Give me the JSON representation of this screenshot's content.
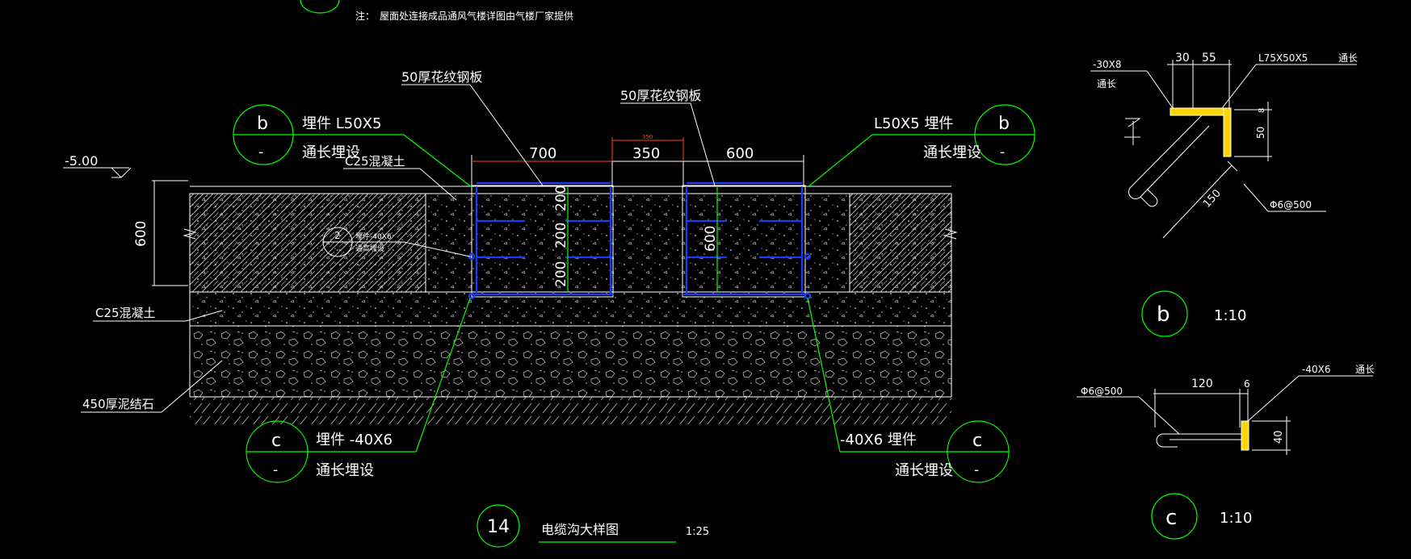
{
  "note": {
    "prefix": "注：",
    "text": "屋面处连接成品通风气楼详图由气楼厂家提供"
  },
  "main": {
    "ref_number": "14",
    "title": "电缆沟大样图",
    "scale": "1:25",
    "elevation": "-5.00",
    "dims": {
      "depth": "600",
      "span_left": "700",
      "span_mid": "350",
      "span_mid_small": "350",
      "span_right": "600",
      "inner_200_a": "200",
      "inner_200_b": "200",
      "inner_200_c": "200",
      "inner_600": "600"
    },
    "labels": {
      "plate_left": "50厚花纹钢板",
      "plate_right": "50厚花纹钢板",
      "c25_top": "C25混凝土",
      "c25_bottom": "C25混凝土",
      "gravel": "450厚泥结石",
      "embed_small_1": "埋件-40X6",
      "embed_small_2": "通高埋设"
    },
    "callout_small_num": "2",
    "callout_small_sub": "-",
    "callout_b_left": {
      "letter": "b",
      "sub": "-",
      "line1": "埋件 L50X5",
      "line2": "通长埋设"
    },
    "callout_b_right": {
      "letter": "b",
      "sub": "-",
      "line1": "L50X5   埋件",
      "line2": "通长埋设"
    },
    "callout_c_left": {
      "letter": "c",
      "sub": "-",
      "line1": "埋件 -40X6",
      "line2": "通长埋设"
    },
    "callout_c_right": {
      "letter": "c",
      "sub": "-",
      "line1": "-40X6   埋件",
      "line2": "通长埋设"
    }
  },
  "detail_b": {
    "letter": "b",
    "scale": "1:10",
    "plate": "-30X8",
    "plate_note": "通长",
    "dim_30": "30",
    "dim_55": "55",
    "angle": "L75X50X5",
    "angle_note": "通长",
    "dim_50": "50",
    "dim_8": "8",
    "dim_150": "150",
    "bar": "Φ6@500"
  },
  "detail_c": {
    "letter": "c",
    "scale": "1:10",
    "bar": "Φ6@500",
    "dim_120": "120",
    "dim_6": "6",
    "plate": "-40X6",
    "plate_note": "通长",
    "dim_40": "40"
  },
  "colors": {
    "background": "#000000",
    "line_white": "#ffffff",
    "callout_green": "#00ff00",
    "steel_blue": "#1a3cff",
    "dimension_red": "#ff3b2f",
    "steel_yellow": "#ffd500"
  }
}
